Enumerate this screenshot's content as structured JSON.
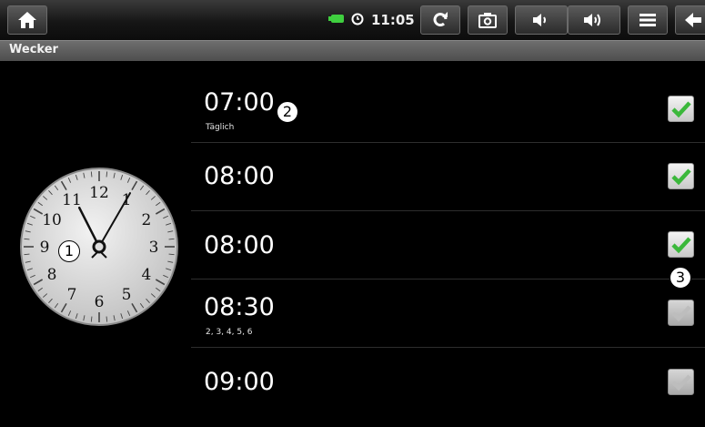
{
  "statusbar": {
    "time": "11:05"
  },
  "title": "Wecker",
  "clock": {
    "numerals": [
      "12",
      "1",
      "2",
      "3",
      "4",
      "5",
      "6",
      "7",
      "8",
      "9",
      "10",
      "11"
    ],
    "hour_hand_value": 11.1,
    "minute_hand_value": 5
  },
  "alarms": [
    {
      "time": "07:00",
      "repeat": "Täglich",
      "enabled": true
    },
    {
      "time": "08:00",
      "repeat": "",
      "enabled": true
    },
    {
      "time": "08:00",
      "repeat": "",
      "enabled": true
    },
    {
      "time": "08:30",
      "repeat": "2, 3, 4, 5, 6",
      "enabled": false
    },
    {
      "time": "09:00",
      "repeat": "",
      "enabled": false
    }
  ],
  "callouts": [
    "1",
    "2",
    "3"
  ],
  "colors": {
    "check_green": "#3bb83b",
    "battery": "#3fcf3f",
    "titlebar": "#5e5e5e"
  },
  "icons": [
    "home-icon",
    "battery-icon",
    "alarm-status-icon",
    "rotate-icon",
    "camera-icon",
    "volume-down-icon",
    "volume-up-icon",
    "menu-icon",
    "back-icon"
  ]
}
